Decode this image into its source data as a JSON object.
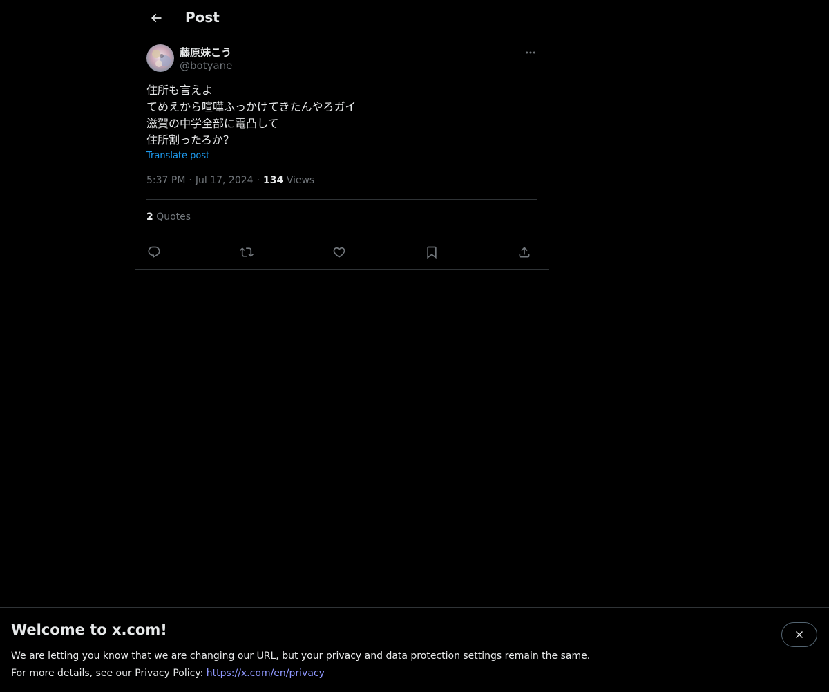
{
  "header": {
    "title": "Post",
    "back_icon": "arrow-left-icon"
  },
  "post": {
    "author_name": "藤原妹こう",
    "author_handle": "@botyane",
    "text_lines": [
      "住所も言えよ",
      "てめえから喧嘩ふっかけてきたんやろガイ",
      "滋賀の中学全部に電凸して",
      "住所割ったろか？"
    ],
    "translate_label": "Translate post",
    "time": "5:37 PM",
    "date": "Jul 17, 2024",
    "views_count": "134",
    "views_label": "Views",
    "quotes_count": "2",
    "quotes_label": "Quotes"
  },
  "actions": [
    "reply-icon",
    "repost-icon",
    "like-icon",
    "bookmark-icon",
    "share-icon"
  ],
  "banner": {
    "title": "Welcome to x.com!",
    "line1": "We are letting you know that we are changing our URL, but your privacy and data protection settings remain the same.",
    "line2_prefix": "For more details, see our Privacy Policy: ",
    "link_text": "https://x.com/en/privacy"
  },
  "colors": {
    "background": "#000000",
    "text": "#e7e9ea",
    "muted": "#71767b",
    "accent": "#1d9bf0",
    "border": "#2f3336"
  }
}
